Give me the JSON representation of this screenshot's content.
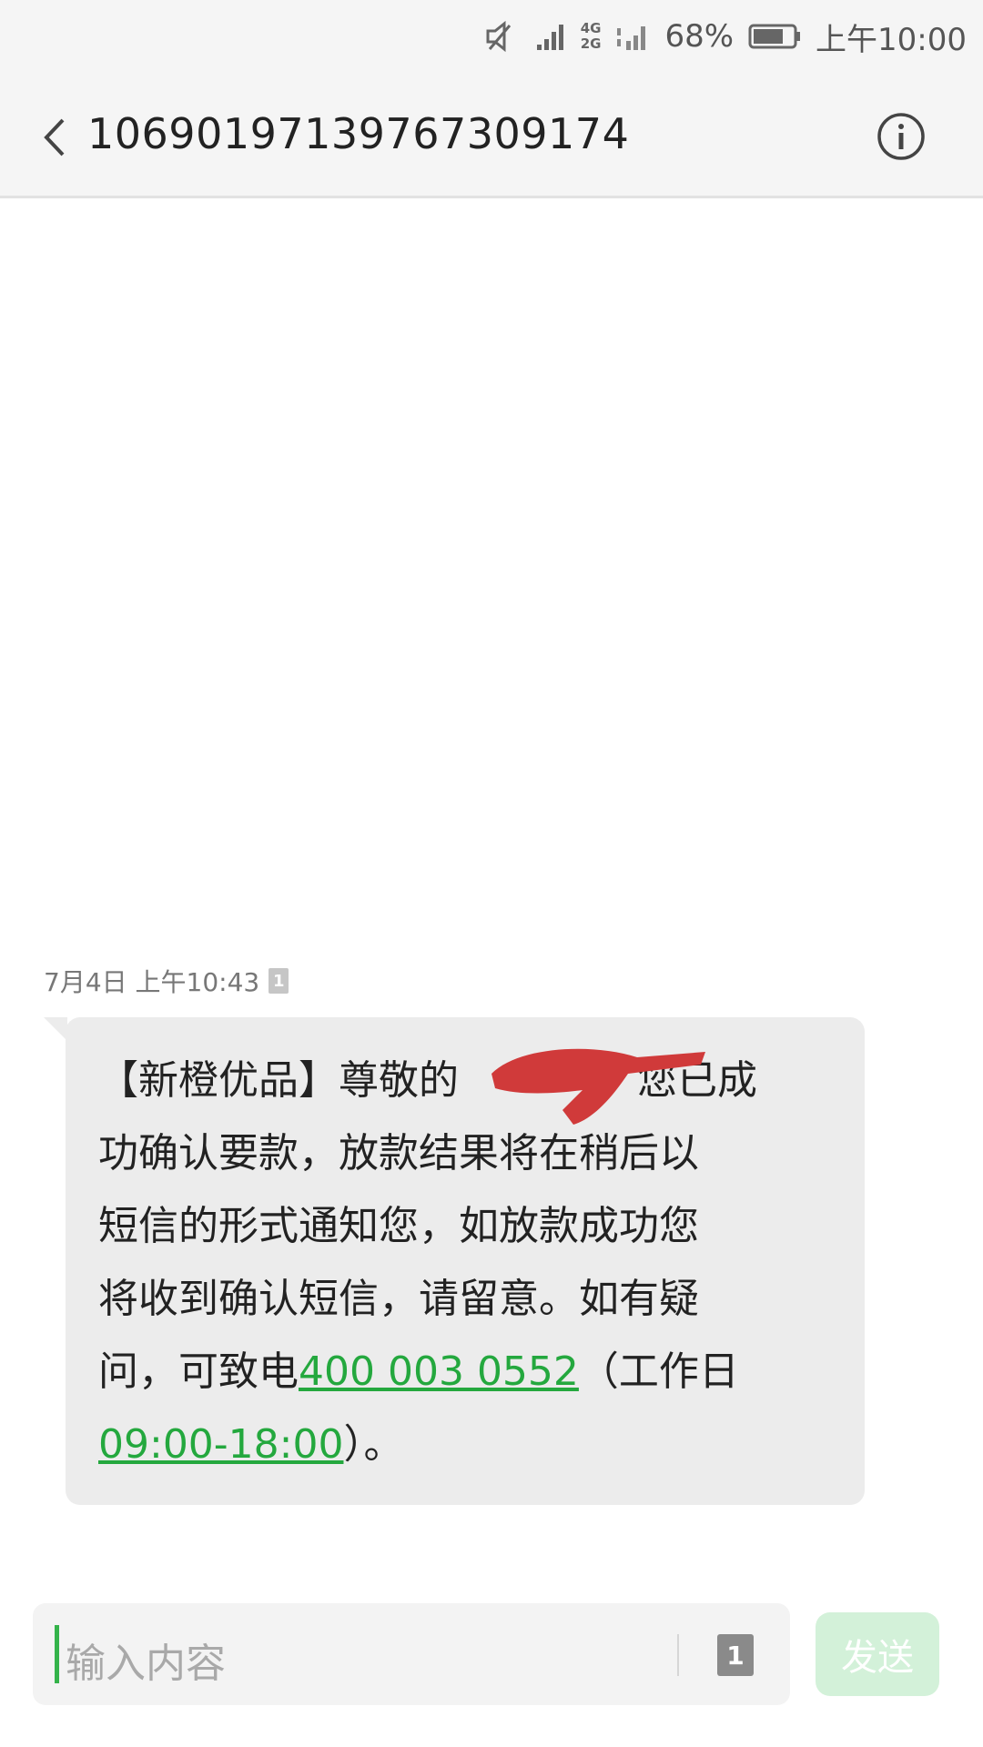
{
  "status_bar": {
    "network_top": "4G",
    "network_bottom": "2G",
    "battery": "68%",
    "time": "上午10:00"
  },
  "header": {
    "title": "106901971397673091​74"
  },
  "message": {
    "timestamp": "7月4日 上午10:43",
    "sim_badge": "1",
    "lines": {
      "l1a": "【新橙优品】尊敬的",
      "l1b": "您已成",
      "l2": "功确认要款，放款结果将在稍后以",
      "l3": "短信的形式通知您，如放款成功您",
      "l4": "将收到确认短信，请留意。如有疑",
      "l5a": "问，可致电",
      "l5_link": "400 003 0552",
      "l5b": "（工作日",
      "l6_link": "09:00-18:00",
      "l6b": "）。"
    }
  },
  "composer": {
    "placeholder": "输入内容",
    "sim_label": "1",
    "send_label": "发送"
  },
  "colors": {
    "accent": "#24a83e",
    "bubble": "#ececec",
    "redaction": "#d03a3a"
  }
}
